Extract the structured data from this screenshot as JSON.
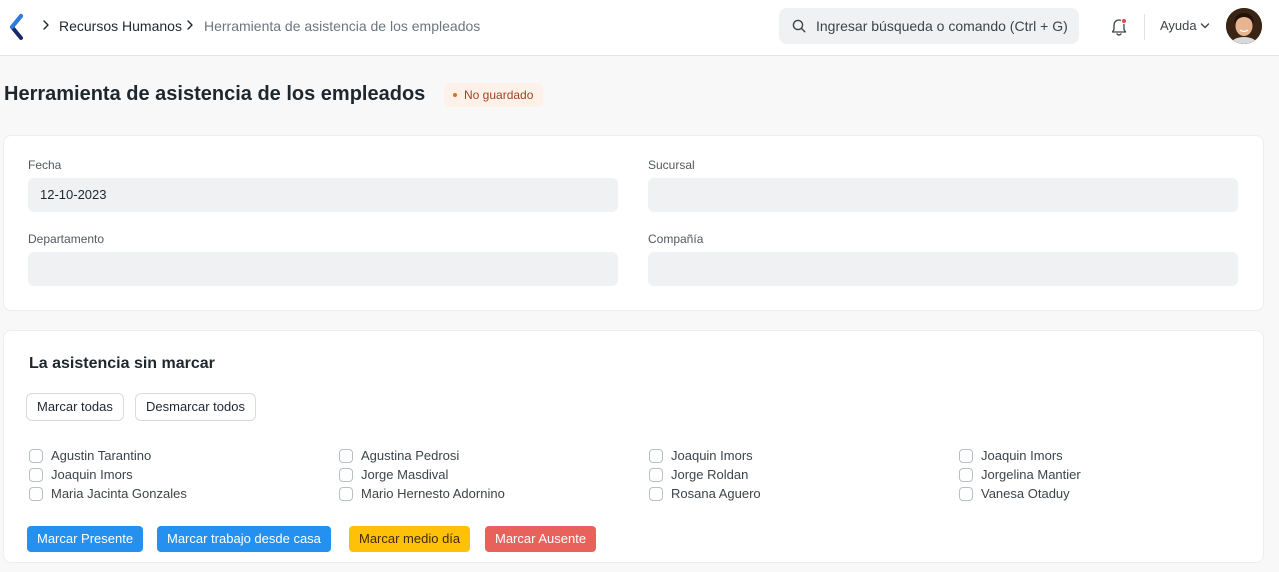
{
  "navbar": {
    "breadcrumbs": [
      "Recursos Humanos",
      "Herramienta de asistencia de los empleados"
    ],
    "search_placeholder": "Ingresar búsqueda o comando (Ctrl + G)",
    "help_label": "Ayuda",
    "icons": [
      "back-chevron-icon",
      "search-icon",
      "bell-icon",
      "chevron-down-icon"
    ],
    "notification_dot_color": "#e24c4c"
  },
  "page": {
    "title": "Herramienta de asistencia de los empleados",
    "status": "No guardado",
    "status_color": "#e86c13"
  },
  "filters": {
    "fecha_label": "Fecha",
    "fecha_value": "12-10-2023",
    "sucursal_label": "Sucursal",
    "sucursal_value": "",
    "departamento_label": "Departamento",
    "departamento_value": "",
    "compania_label": "Compañía",
    "compania_value": ""
  },
  "attendance": {
    "title": "La asistencia sin marcar",
    "mark_all_label": "Marcar todas",
    "unmark_all_label": "Desmarcar todos",
    "columns": [
      [
        "Agustin Tarantino",
        "Joaquin Imors",
        "Maria Jacinta Gonzales"
      ],
      [
        "Agustina Pedrosi",
        "Jorge Masdival",
        "Mario Hernesto Adornino"
      ],
      [
        "Joaquin Imors",
        "Jorge Roldan",
        "Rosana Aguero"
      ],
      [
        "Joaquin Imors",
        "Jorgelina Mantier",
        "Vanesa Otaduy"
      ]
    ],
    "actions": {
      "present": "Marcar Presente",
      "work_from_home": "Marcar trabajo desde casa",
      "half_day": "Marcar medio día",
      "absent": "Marcar Ausente"
    },
    "action_colors": {
      "present": "#2490ef",
      "work_from_home": "#2490ef",
      "half_day": "#ffc107",
      "absent": "#e8625b"
    }
  }
}
